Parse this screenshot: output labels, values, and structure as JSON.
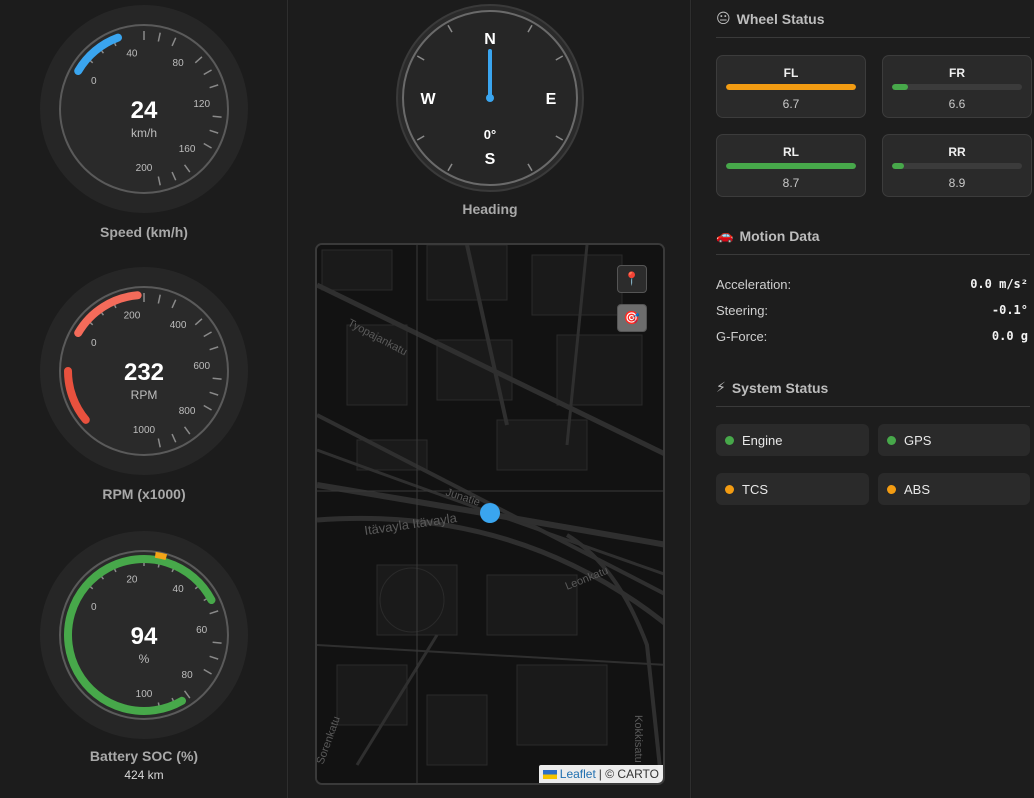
{
  "gauges": [
    {
      "id": "speed",
      "value": "24",
      "unit": "km/h",
      "caption": "Speed (km/h)",
      "sub": "",
      "ticks": [
        "0",
        "40",
        "80",
        "120",
        "160",
        "200"
      ],
      "level": 0.12,
      "color": "#3aa5ef",
      "secondary_color": ""
    },
    {
      "id": "rpm",
      "value": "232",
      "unit": "RPM",
      "caption": "RPM (x1000)",
      "sub": "",
      "ticks": [
        "0",
        "200",
        "400",
        "600",
        "800",
        "1000"
      ],
      "level": 0.23,
      "color": "#f46b5a",
      "secondary_color": "#e8513e"
    },
    {
      "id": "battery",
      "value": "94",
      "unit": "%",
      "caption": "Battery SOC (%)",
      "sub": "424 km",
      "ticks": [
        "0",
        "20",
        "40",
        "60",
        "80",
        "100"
      ],
      "level": 0.94,
      "color": "#47a84a",
      "secondary_color": "#f2a417"
    }
  ],
  "compass": {
    "n": "N",
    "e": "E",
    "s": "S",
    "w": "W",
    "degrees": "0°",
    "caption": "Heading",
    "needle_color": "#3aa5ef"
  },
  "map": {
    "streets": [
      "Tyopajankatu",
      "Junatie",
      "Itävayla Itävayla",
      "Leonkatu",
      "Kokkisatu",
      "Sorenkatu"
    ],
    "attribution_link": "Leaflet",
    "attribution_text": "| © CARTO",
    "marker_color": "#3aa5ef",
    "pin_button_icon": "📍",
    "target_button_icon": "🎯"
  },
  "wheel_status": {
    "title": "Wheel Status",
    "icon": "😐",
    "wheels": [
      {
        "label": "FL",
        "value": "6.7",
        "level": 1.0,
        "color": "#f39c12"
      },
      {
        "label": "FR",
        "value": "6.6",
        "level": 0.12,
        "color": "#47a84a"
      },
      {
        "label": "RL",
        "value": "8.7",
        "level": 1.0,
        "color": "#47a84a"
      },
      {
        "label": "RR",
        "value": "8.9",
        "level": 0.09,
        "color": "#47a84a"
      }
    ]
  },
  "motion": {
    "title": "Motion Data",
    "icon": "🚗",
    "rows": [
      {
        "label": "Acceleration:",
        "value": "0.0 m/s²"
      },
      {
        "label": "Steering:",
        "value": "-0.1°"
      },
      {
        "label": "G-Force:",
        "value": "0.0 g"
      }
    ]
  },
  "system": {
    "title": "System Status",
    "icon": "⚡",
    "items": [
      {
        "label": "Engine",
        "color": "#47a84a"
      },
      {
        "label": "GPS",
        "color": "#47a84a"
      },
      {
        "label": "TCS",
        "color": "#f39c12"
      },
      {
        "label": "ABS",
        "color": "#f39c12"
      }
    ]
  }
}
